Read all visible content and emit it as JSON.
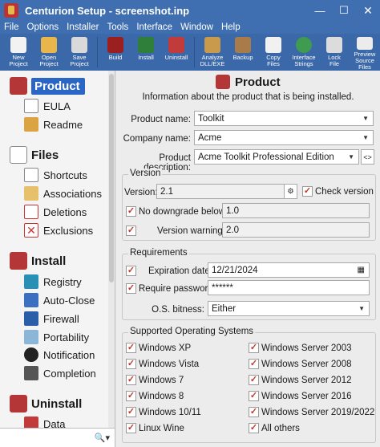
{
  "window": {
    "title": "Centurion Setup - screenshot.inp",
    "min_glyph": "—",
    "max_glyph": "☐",
    "close_glyph": "✕"
  },
  "menu": [
    "File",
    "Options",
    "Installer",
    "Tools",
    "Interface",
    "Window",
    "Help"
  ],
  "toolbar": [
    {
      "label": "New\nProject",
      "icon": "new-project-icon",
      "color": "#f2f2f2"
    },
    {
      "label": "Open\nProject",
      "icon": "open-project-icon",
      "color": "#e8b64a"
    },
    {
      "label": "Save\nProject",
      "icon": "save-project-icon",
      "color": "#d9d9d9"
    },
    {
      "label": "Build",
      "icon": "build-icon",
      "color": "#9b1f1f"
    },
    {
      "label": "Install",
      "icon": "install-icon",
      "color": "#2f7f3a"
    },
    {
      "label": "Uninstall",
      "icon": "uninstall-icon",
      "color": "#c23b3b"
    },
    {
      "label": "Analyze\nDLL/EXE",
      "icon": "analyze-icon",
      "color": "#c99a4b"
    },
    {
      "label": "Backup",
      "icon": "backup-icon",
      "color": "#a97b4a"
    },
    {
      "label": "Copy\nFiles",
      "icon": "copy-files-icon",
      "color": "#f1f1f1"
    },
    {
      "label": "Interface\nStrings",
      "icon": "globe-icon",
      "color": "#3f9b4f"
    },
    {
      "label": "Lock\nFile",
      "icon": "lock-icon",
      "color": "#dcdcdc"
    },
    {
      "label": "Preview\nSource Files",
      "icon": "preview-icon",
      "color": "#ececec"
    }
  ],
  "sidebar": {
    "groups": [
      {
        "label": "Product",
        "icon": "product-icon",
        "selected": true,
        "items": [
          {
            "label": "EULA",
            "icon": "eula-icon"
          },
          {
            "label": "Readme",
            "icon": "readme-icon"
          }
        ]
      },
      {
        "label": "Files",
        "icon": "files-icon",
        "selected": false,
        "items": [
          {
            "label": "Shortcuts",
            "icon": "shortcut-icon"
          },
          {
            "label": "Associations",
            "icon": "associations-icon"
          },
          {
            "label": "Deletions",
            "icon": "deletions-icon"
          },
          {
            "label": "Exclusions",
            "icon": "exclusions-icon"
          }
        ]
      },
      {
        "label": "Install",
        "icon": "install-group-icon",
        "selected": false,
        "items": [
          {
            "label": "Registry",
            "icon": "registry-icon"
          },
          {
            "label": "Auto-Close",
            "icon": "auto-close-icon"
          },
          {
            "label": "Firewall",
            "icon": "firewall-icon"
          },
          {
            "label": "Portability",
            "icon": "portability-icon"
          },
          {
            "label": "Notification",
            "icon": "notification-icon"
          },
          {
            "label": "Completion",
            "icon": "completion-icon"
          }
        ]
      },
      {
        "label": "Uninstall",
        "icon": "uninstall-group-icon",
        "selected": false,
        "items": [
          {
            "label": "Data",
            "icon": "data-icon"
          }
        ]
      }
    ],
    "search_glyph": "🔍▾"
  },
  "page": {
    "title": "Product",
    "subtitle": "Information about the product that is being installed."
  },
  "product": {
    "name_label": "Product name:",
    "name_value": "Toolkit",
    "company_label": "Company name:",
    "company_value": "Acme",
    "description_label": "Product description:",
    "description_value": "Acme Toolkit Professional Edition",
    "description_btn": "<>"
  },
  "version": {
    "legend": "Version",
    "version_label": "Version:",
    "version_value": "2.1",
    "check_version_label": "Check version",
    "check_version_checked": true,
    "no_downgrade_label": "No downgrade below:",
    "no_downgrade_checked": true,
    "no_downgrade_value": "1.0",
    "warning_label": "Version warning:",
    "warning_checked": true,
    "warning_value": "2.0"
  },
  "requirements": {
    "legend": "Requirements",
    "expiration_label": "Expiration date:",
    "expiration_checked": true,
    "expiration_value": "12/21/2024",
    "password_label": "Require password:",
    "password_checked": true,
    "password_value": "******",
    "bitness_label": "O.S. bitness:",
    "bitness_value": "Either"
  },
  "os": {
    "legend": "Supported Operating Systems",
    "left": [
      {
        "label": "Windows XP",
        "checked": true
      },
      {
        "label": "Windows Vista",
        "checked": true
      },
      {
        "label": "Windows 7",
        "checked": true
      },
      {
        "label": "Windows 8",
        "checked": true
      },
      {
        "label": "Windows 10/11",
        "checked": true
      },
      {
        "label": "Linux Wine",
        "checked": true
      }
    ],
    "right": [
      {
        "label": "Windows Server 2003",
        "checked": true
      },
      {
        "label": "Windows Server 2008",
        "checked": true
      },
      {
        "label": "Windows Server 2012",
        "checked": true
      },
      {
        "label": "Windows Server 2016",
        "checked": true
      },
      {
        "label": "Windows Server 2019/2022",
        "checked": true
      },
      {
        "label": "All others",
        "checked": true
      }
    ]
  },
  "colors": {
    "titlebar": "#3f6fb0",
    "toolbar": "#3b68a8",
    "selection": "#2c66c4",
    "check": "#c0392b"
  }
}
